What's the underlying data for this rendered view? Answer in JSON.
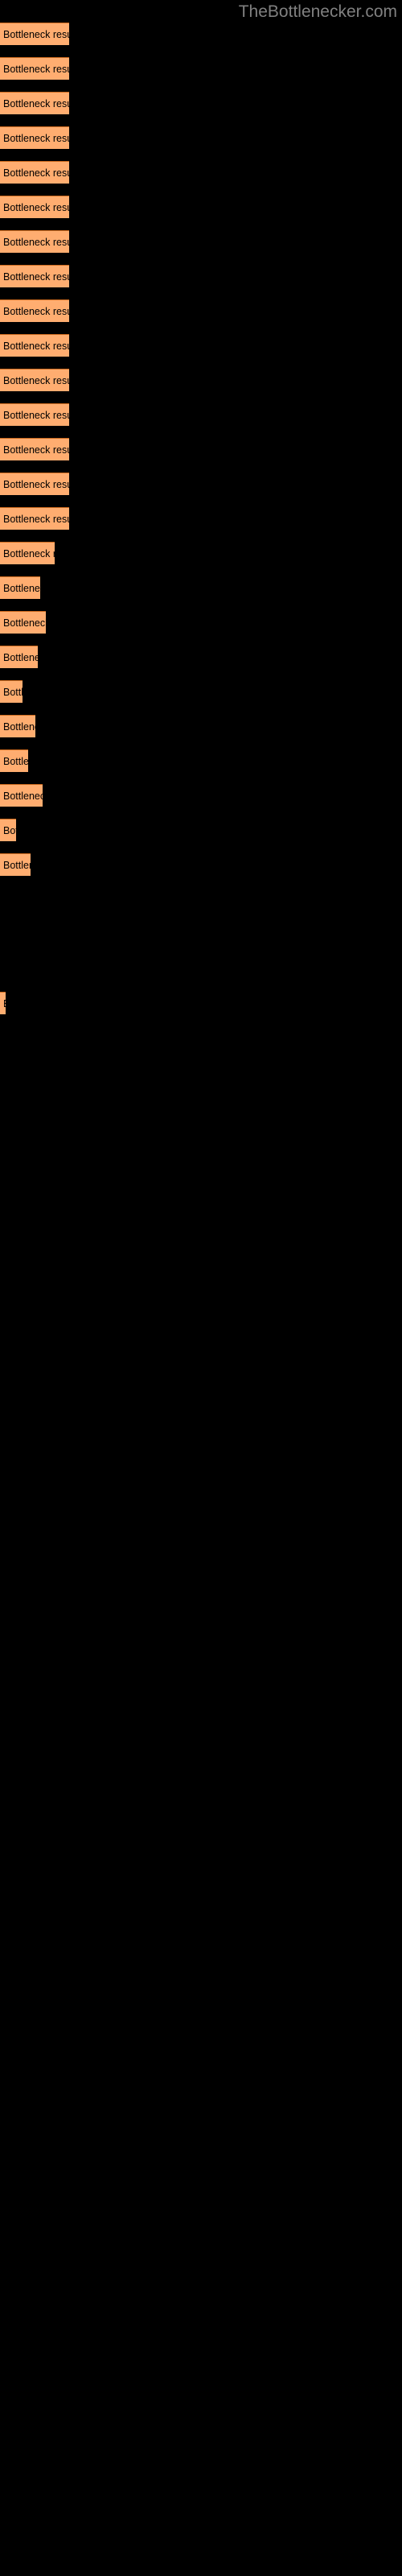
{
  "site": {
    "title": "TheBottlenecker.com",
    "title_color": "#808080"
  },
  "theme": {
    "background": "#000000",
    "bar_fill": "#ffad70",
    "bar_border": "#cc6a1f",
    "label_color": "#000000"
  },
  "chart_data": {
    "type": "bar",
    "orientation": "horizontal",
    "title": "TheBottlenecker.com",
    "xlabel": "",
    "ylabel": "",
    "grid": false,
    "legend": null,
    "bar_label_text": "Bottleneck result",
    "categories": [
      "Bottleneck result",
      "Bottleneck result",
      "Bottleneck result",
      "Bottleneck result",
      "Bottleneck result",
      "Bottleneck result",
      "Bottleneck result",
      "Bottleneck result",
      "Bottleneck result",
      "Bottleneck result",
      "Bottleneck result",
      "Bottleneck result",
      "Bottleneck result",
      "Bottleneck result",
      "Bottleneck result",
      "Bottleneck result",
      "Bottleneck result",
      "Bottleneck result",
      "Bottleneck result",
      "Bottleneck result",
      "Bottleneck result",
      "Bottleneck result",
      "Bottleneck result",
      "Bottleneck result",
      "Bottleneck result",
      "Bottleneck result"
    ],
    "values": [
      86,
      86,
      86,
      86,
      86,
      86,
      86,
      86,
      86,
      86,
      86,
      86,
      86,
      86,
      86,
      68,
      50,
      57,
      47,
      28,
      44,
      35,
      53,
      20,
      38,
      7
    ],
    "xlim": [
      0,
      500
    ],
    "ylim": null
  },
  "bars": [
    {
      "label": "Bottleneck result",
      "width": 86,
      "top": 28
    },
    {
      "label": "Bottleneck result",
      "width": 86,
      "top": 71
    },
    {
      "label": "Bottleneck result",
      "width": 86,
      "top": 114
    },
    {
      "label": "Bottleneck result",
      "width": 86,
      "top": 157
    },
    {
      "label": "Bottleneck result",
      "width": 86,
      "top": 200
    },
    {
      "label": "Bottleneck result",
      "width": 86,
      "top": 243
    },
    {
      "label": "Bottleneck result",
      "width": 86,
      "top": 286
    },
    {
      "label": "Bottleneck result",
      "width": 86,
      "top": 329
    },
    {
      "label": "Bottleneck result",
      "width": 86,
      "top": 372
    },
    {
      "label": "Bottleneck result",
      "width": 86,
      "top": 415
    },
    {
      "label": "Bottleneck result",
      "width": 86,
      "top": 458
    },
    {
      "label": "Bottleneck result",
      "width": 86,
      "top": 501
    },
    {
      "label": "Bottleneck result",
      "width": 86,
      "top": 544
    },
    {
      "label": "Bottleneck result",
      "width": 86,
      "top": 587
    },
    {
      "label": "Bottleneck result",
      "width": 86,
      "top": 630
    },
    {
      "label": "Bottleneck result",
      "width": 68,
      "top": 673
    },
    {
      "label": "Bottleneck result",
      "width": 50,
      "top": 716
    },
    {
      "label": "Bottleneck result",
      "width": 57,
      "top": 759
    },
    {
      "label": "Bottleneck result",
      "width": 47,
      "top": 802
    },
    {
      "label": "Bottleneck result",
      "width": 28,
      "top": 845
    },
    {
      "label": "Bottleneck result",
      "width": 44,
      "top": 888
    },
    {
      "label": "Bottleneck result",
      "width": 35,
      "top": 931
    },
    {
      "label": "Bottleneck result",
      "width": 53,
      "top": 974
    },
    {
      "label": "Bottleneck result",
      "width": 20,
      "top": 1017
    },
    {
      "label": "Bottleneck result",
      "width": 38,
      "top": 1060
    },
    {
      "label": "Bottleneck result",
      "width": 7,
      "top": 1232
    }
  ]
}
